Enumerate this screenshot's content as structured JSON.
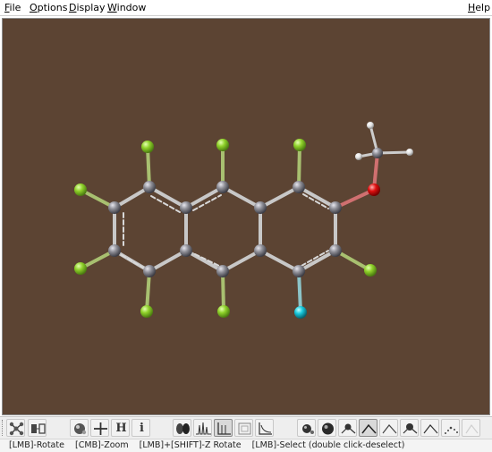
{
  "menubar": {
    "file": "File",
    "options": "Options",
    "display": "Display",
    "window": "Window",
    "help": "Help"
  },
  "viewport": {
    "background_color": "#5c4433",
    "atom_colors": {
      "carbon": "#8e8e96",
      "hydrogen": "#e8e8e8",
      "fluorine": "#8fd12a",
      "oxygen": "#e01010",
      "chlorine_like_cyan": "#18c8dc"
    }
  },
  "toolbar": {
    "buttons": [
      {
        "name": "molecule-builder-icon",
        "pressed": false
      },
      {
        "name": "fragment-icon",
        "pressed": false
      },
      {
        "name": "sphere-render-icon",
        "pressed": false
      },
      {
        "name": "crosshair-icon",
        "pressed": false
      },
      {
        "name": "label-h-icon",
        "pressed": false,
        "glyph": "H"
      },
      {
        "name": "info-icon",
        "pressed": false,
        "glyph": "i"
      },
      {
        "name": "orbital-icon",
        "pressed": false
      },
      {
        "name": "spectrum-icon",
        "pressed": false
      },
      {
        "name": "axes-icon",
        "pressed": true
      },
      {
        "name": "box-icon",
        "pressed": false
      },
      {
        "name": "graph-icon",
        "pressed": false
      },
      {
        "name": "ball-stick-icon",
        "pressed": false
      },
      {
        "name": "space-fill-icon",
        "pressed": false
      },
      {
        "name": "bond-add-icon",
        "pressed": false
      },
      {
        "name": "angle-icon",
        "pressed": true
      },
      {
        "name": "angle-plain-icon",
        "pressed": false
      },
      {
        "name": "bond-angle-icon",
        "pressed": false
      },
      {
        "name": "dihedral-icon",
        "pressed": false
      },
      {
        "name": "dotted-angle-icon",
        "pressed": false
      },
      {
        "name": "blank-tool-icon",
        "pressed": false
      }
    ]
  },
  "status": {
    "text": "[LMB]-Rotate    [CMB]-Zoom    [LMB]+[SHIFT]-Z Rotate    [LMB]-Select (double click-deselect)"
  }
}
